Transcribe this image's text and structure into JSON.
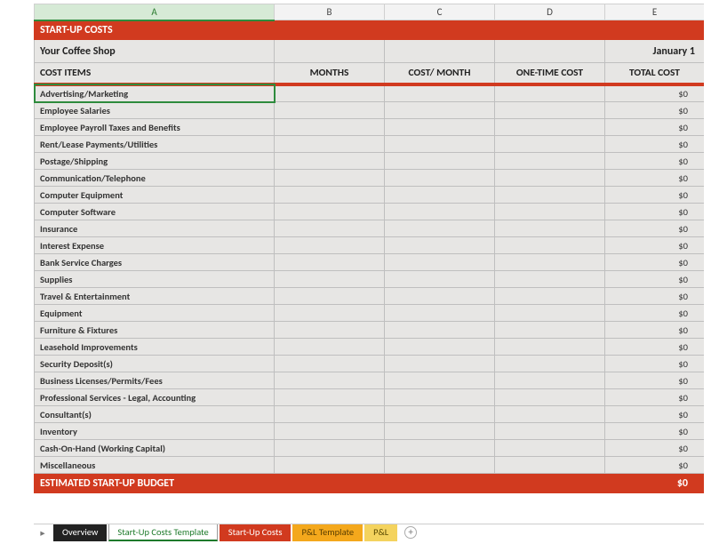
{
  "columns": [
    "A",
    "B",
    "C",
    "D",
    "E"
  ],
  "selected_column": "A",
  "title": "START-UP COSTS",
  "company": "Your Coffee Shop",
  "date_label": "January 1",
  "headers": {
    "items": "COST ITEMS",
    "months": "MONTHS",
    "cost_month": "COST/ MONTH",
    "one_time": "ONE-TIME COST",
    "total": "TOTAL COST"
  },
  "rows": [
    {
      "label": "Advertising/Marketing",
      "months": "",
      "cost_month": "",
      "one_time": "",
      "total": "$0"
    },
    {
      "label": "Employee Salaries",
      "months": "",
      "cost_month": "",
      "one_time": "",
      "total": "$0"
    },
    {
      "label": "Employee Payroll Taxes and Benefits",
      "months": "",
      "cost_month": "",
      "one_time": "",
      "total": "$0"
    },
    {
      "label": "Rent/Lease Payments/Utilities",
      "months": "",
      "cost_month": "",
      "one_time": "",
      "total": "$0"
    },
    {
      "label": "Postage/Shipping",
      "months": "",
      "cost_month": "",
      "one_time": "",
      "total": "$0"
    },
    {
      "label": "Communication/Telephone",
      "months": "",
      "cost_month": "",
      "one_time": "",
      "total": "$0"
    },
    {
      "label": "Computer Equipment",
      "months": "",
      "cost_month": "",
      "one_time": "",
      "total": "$0"
    },
    {
      "label": "Computer Software",
      "months": "",
      "cost_month": "",
      "one_time": "",
      "total": "$0"
    },
    {
      "label": "Insurance",
      "months": "",
      "cost_month": "",
      "one_time": "",
      "total": "$0"
    },
    {
      "label": "Interest Expense",
      "months": "",
      "cost_month": "",
      "one_time": "",
      "total": "$0"
    },
    {
      "label": "Bank Service Charges",
      "months": "",
      "cost_month": "",
      "one_time": "",
      "total": "$0"
    },
    {
      "label": "Supplies",
      "months": "",
      "cost_month": "",
      "one_time": "",
      "total": "$0"
    },
    {
      "label": "Travel & Entertainment",
      "months": "",
      "cost_month": "",
      "one_time": "",
      "total": "$0"
    },
    {
      "label": "Equipment",
      "months": "",
      "cost_month": "",
      "one_time": "",
      "total": "$0"
    },
    {
      "label": "Furniture & Fixtures",
      "months": "",
      "cost_month": "",
      "one_time": "",
      "total": "$0"
    },
    {
      "label": "Leasehold Improvements",
      "months": "",
      "cost_month": "",
      "one_time": "",
      "total": "$0"
    },
    {
      "label": "Security Deposit(s)",
      "months": "",
      "cost_month": "",
      "one_time": "",
      "total": "$0"
    },
    {
      "label": "Business Licenses/Permits/Fees",
      "months": "",
      "cost_month": "",
      "one_time": "",
      "total": "$0"
    },
    {
      "label": "Professional Services - Legal, Accounting",
      "months": "",
      "cost_month": "",
      "one_time": "",
      "total": "$0"
    },
    {
      "label": "Consultant(s)",
      "months": "",
      "cost_month": "",
      "one_time": "",
      "total": "$0"
    },
    {
      "label": "Inventory",
      "months": "",
      "cost_month": "",
      "one_time": "",
      "total": "$0"
    },
    {
      "label": "Cash-On-Hand (Working Capital)",
      "months": "",
      "cost_month": "",
      "one_time": "",
      "total": "$0"
    },
    {
      "label": "Miscellaneous",
      "months": "",
      "cost_month": "",
      "one_time": "",
      "total": "$0"
    }
  ],
  "budget_label": "ESTIMATED START-UP BUDGET",
  "budget_total": "$0",
  "tabs": [
    {
      "label": "Overview",
      "style": "black"
    },
    {
      "label": "Start-Up Costs Template",
      "style": "green"
    },
    {
      "label": "Start-Up Costs",
      "style": "red"
    },
    {
      "label": "P&L Template",
      "style": "orange"
    },
    {
      "label": "P&L",
      "style": "yellow"
    }
  ],
  "tab_nav_glyph": "▸",
  "add_sheet_glyph": "+"
}
